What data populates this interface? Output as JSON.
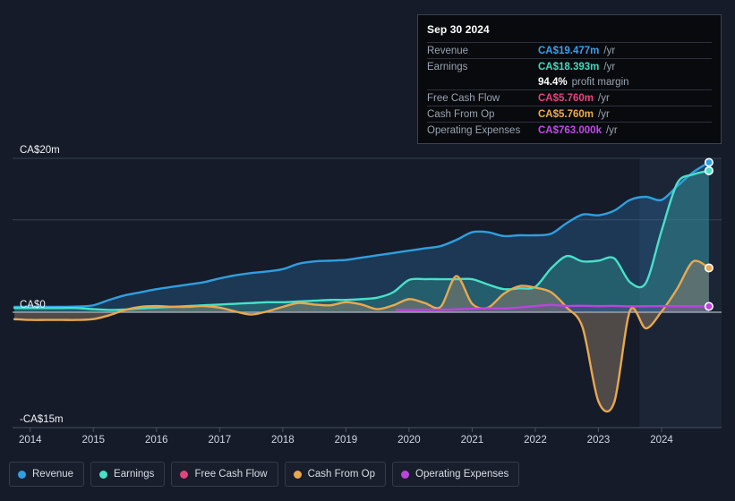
{
  "chart_data": {
    "type": "line",
    "title": "",
    "xlabel": "",
    "ylabel": "",
    "currency": "CA$",
    "x_tick_labels": [
      "2014",
      "2015",
      "2016",
      "2017",
      "2018",
      "2019",
      "2020",
      "2021",
      "2022",
      "2023",
      "2024"
    ],
    "x_ticks": [
      2014,
      2015,
      2016,
      2017,
      2018,
      2019,
      2020,
      2021,
      2022,
      2023,
      2024
    ],
    "xlim": [
      2013.72,
      2024.95
    ],
    "ylim": [
      -15,
      20
    ],
    "y_tick_labels": [
      "CA$20m",
      "CA$0",
      "-CA$15m"
    ],
    "y_ticks": [
      20,
      0,
      -15
    ],
    "gridlines": [
      20,
      12,
      0,
      -15
    ],
    "grid": true,
    "legend_position": "bottom",
    "forecast_band_start": 2023.65,
    "series": [
      {
        "name": "Revenue",
        "color": "#2e9fe0",
        "fill": "rgba(46,126,190,0.30)",
        "end_value": 19.477,
        "x": [
          2013.75,
          2014.0,
          2014.25,
          2014.5,
          2014.75,
          2015.0,
          2015.25,
          2015.5,
          2015.75,
          2016.0,
          2016.25,
          2016.5,
          2016.75,
          2017.0,
          2017.25,
          2017.5,
          2017.75,
          2018.0,
          2018.25,
          2018.5,
          2018.75,
          2019.0,
          2019.25,
          2019.5,
          2019.75,
          2020.0,
          2020.25,
          2020.5,
          2020.75,
          2021.0,
          2021.25,
          2021.5,
          2021.75,
          2022.0,
          2022.25,
          2022.5,
          2022.75,
          2023.0,
          2023.25,
          2023.5,
          2023.75,
          2024.0,
          2024.25,
          2024.5,
          2024.75
        ],
        "values": [
          0.7,
          0.7,
          0.7,
          0.7,
          0.75,
          0.9,
          1.6,
          2.2,
          2.6,
          3.0,
          3.3,
          3.6,
          3.9,
          4.4,
          4.8,
          5.1,
          5.3,
          5.6,
          6.3,
          6.6,
          6.7,
          6.8,
          7.1,
          7.4,
          7.7,
          8.0,
          8.3,
          8.6,
          9.4,
          10.4,
          10.4,
          9.9,
          10.0,
          10.0,
          10.2,
          11.6,
          12.7,
          12.6,
          13.2,
          14.6,
          15.0,
          14.6,
          16.4,
          18.2,
          19.477
        ]
      },
      {
        "name": "Earnings",
        "color": "#48e0c8",
        "fill": "rgba(56,180,165,0.30)",
        "end_value": 18.393,
        "profit_margin": "94.4%",
        "x": [
          2013.75,
          2014.0,
          2014.25,
          2014.5,
          2014.75,
          2015.0,
          2015.25,
          2015.5,
          2015.75,
          2016.0,
          2016.25,
          2016.5,
          2016.75,
          2017.0,
          2017.25,
          2017.5,
          2017.75,
          2018.0,
          2018.25,
          2018.5,
          2018.75,
          2019.0,
          2019.25,
          2019.5,
          2019.75,
          2020.0,
          2020.25,
          2020.5,
          2020.75,
          2021.0,
          2021.25,
          2021.5,
          2021.75,
          2022.0,
          2022.25,
          2022.5,
          2022.75,
          2023.0,
          2023.25,
          2023.5,
          2023.75,
          2024.0,
          2024.25,
          2024.5,
          2024.75
        ],
        "values": [
          0.55,
          0.55,
          0.55,
          0.55,
          0.55,
          0.4,
          0.3,
          0.35,
          0.5,
          0.6,
          0.7,
          0.8,
          0.9,
          1.0,
          1.1,
          1.2,
          1.3,
          1.3,
          1.4,
          1.5,
          1.6,
          1.6,
          1.7,
          1.9,
          2.6,
          4.2,
          4.3,
          4.3,
          4.3,
          4.3,
          3.6,
          3.0,
          3.1,
          3.3,
          5.7,
          7.3,
          6.6,
          6.7,
          7.0,
          3.9,
          3.8,
          10.6,
          16.8,
          17.9,
          18.393
        ]
      },
      {
        "name": "Free Cash Flow",
        "color": "#e0457b",
        "fill": "rgba(150,40,55,0.35)",
        "end_value": 5.76,
        "x": [
          2013.75,
          2024.75
        ],
        "values": [
          null,
          null
        ]
      },
      {
        "name": "Cash From Op",
        "color": "#e8a84f",
        "fill": "rgba(150,130,110,0.45)",
        "end_value": 5.76,
        "x": [
          2013.75,
          2014.0,
          2014.25,
          2014.5,
          2014.75,
          2015.0,
          2015.25,
          2015.5,
          2015.75,
          2016.0,
          2016.25,
          2016.5,
          2016.75,
          2017.0,
          2017.25,
          2017.5,
          2017.75,
          2018.0,
          2018.25,
          2018.5,
          2018.75,
          2019.0,
          2019.25,
          2019.5,
          2019.75,
          2020.0,
          2020.25,
          2020.5,
          2020.75,
          2021.0,
          2021.25,
          2021.5,
          2021.75,
          2022.0,
          2022.25,
          2022.5,
          2022.75,
          2023.0,
          2023.25,
          2023.5,
          2023.75,
          2024.0,
          2024.25,
          2024.5,
          2024.75
        ],
        "values": [
          -0.9,
          -1.0,
          -1.0,
          -1.0,
          -1.0,
          -0.9,
          -0.4,
          0.3,
          0.7,
          0.8,
          0.7,
          0.7,
          0.8,
          0.6,
          0.1,
          -0.3,
          0.1,
          0.7,
          1.2,
          1.0,
          0.9,
          1.3,
          1.0,
          0.4,
          0.9,
          1.7,
          1.2,
          0.7,
          4.7,
          1.1,
          0.6,
          2.4,
          3.4,
          3.2,
          2.6,
          0.6,
          -2.0,
          -11.6,
          -11.7,
          0.2,
          -2.1,
          0.1,
          3.1,
          6.6,
          5.76
        ]
      },
      {
        "name": "Operating Expenses",
        "color": "#bb44dd",
        "fill": "rgba(130,60,180,0.20)",
        "end_value": 0.763,
        "x": [
          2019.8,
          2020.0,
          2020.25,
          2020.5,
          2020.75,
          2021.0,
          2021.25,
          2021.5,
          2021.75,
          2022.0,
          2022.25,
          2022.5,
          2022.75,
          2023.0,
          2023.25,
          2023.5,
          2023.75,
          2024.0,
          2024.25,
          2024.5,
          2024.75
        ],
        "values": [
          0.28,
          0.28,
          0.3,
          0.32,
          0.38,
          0.45,
          0.52,
          0.48,
          0.62,
          0.8,
          0.95,
          0.82,
          0.84,
          0.8,
          0.82,
          0.76,
          0.78,
          0.8,
          0.78,
          0.76,
          0.763
        ]
      }
    ]
  },
  "tooltip": {
    "date": "Sep 30 2024",
    "rows": [
      {
        "label": "Revenue",
        "value": "CA$19.477m",
        "unit": "/yr",
        "color": "#3aa0ee"
      },
      {
        "label": "Earnings",
        "value": "CA$18.393m",
        "unit": "/yr",
        "color": "#3ddcc0"
      },
      {
        "label": "",
        "value": "94.4%",
        "unit": "profit margin",
        "color": "#ffffff",
        "is_margin": true
      },
      {
        "label": "Free Cash Flow",
        "value": "CA$5.760m",
        "unit": "/yr",
        "color": "#e8437e"
      },
      {
        "label": "Cash From Op",
        "value": "CA$5.760m",
        "unit": "/yr",
        "color": "#ecab4e"
      },
      {
        "label": "Operating Expenses",
        "value": "CA$763.000k",
        "unit": "/yr",
        "color": "#c24ae8"
      }
    ]
  },
  "legend": {
    "items": [
      {
        "label": "Revenue",
        "color": "#2e9fe0"
      },
      {
        "label": "Earnings",
        "color": "#48e0c8"
      },
      {
        "label": "Free Cash Flow",
        "color": "#e0457b"
      },
      {
        "label": "Cash From Op",
        "color": "#e8a84f"
      },
      {
        "label": "Operating Expenses",
        "color": "#bb44dd"
      }
    ]
  },
  "axes": {
    "y_top_label": "CA$20m",
    "y_zero_label": "CA$0",
    "y_bottom_label": "-CA$15m"
  }
}
